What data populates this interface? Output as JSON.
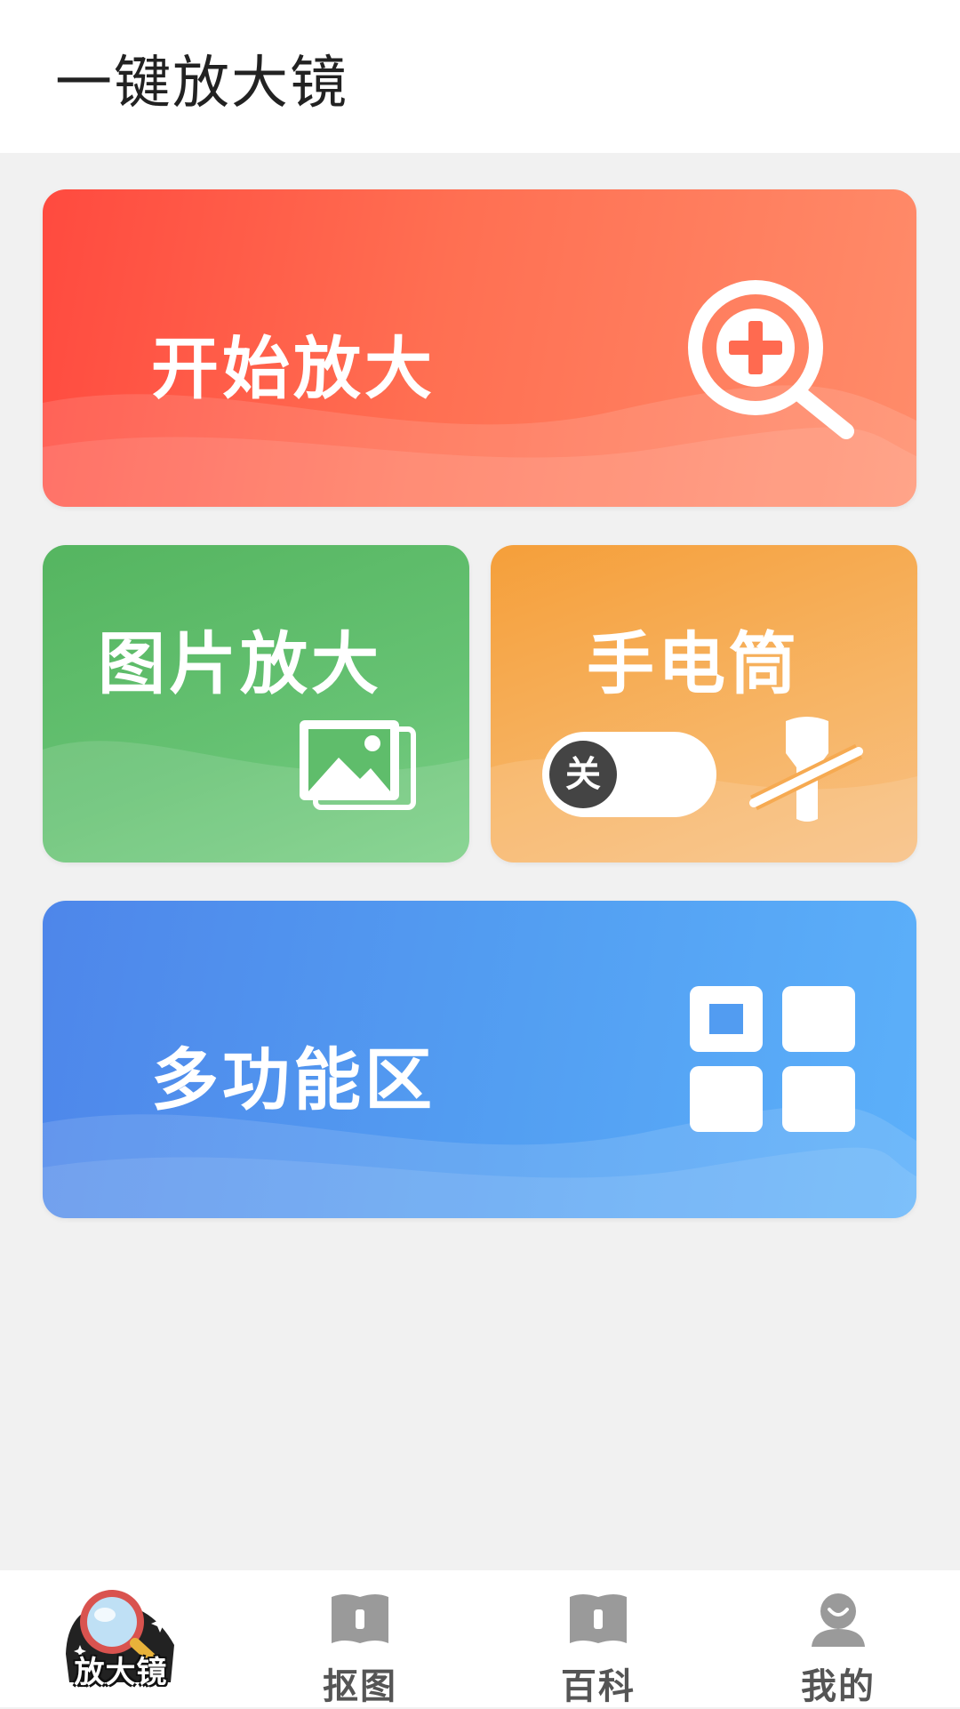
{
  "app": {
    "title": "一键放大镜"
  },
  "cards": {
    "zoom": {
      "label": "开始放大",
      "icon": "zoom-in-icon"
    },
    "picture": {
      "label": "图片放大",
      "icon": "image-icon"
    },
    "flashlight": {
      "label": "手电筒",
      "toggle_label": "关",
      "toggle_state": "off",
      "icon": "flashlight-off-icon"
    },
    "multi": {
      "label": "多功能区",
      "icon": "grid-icon"
    }
  },
  "tabbar": {
    "tabs": [
      {
        "label": "放大镜",
        "icon": "magnifier-logo-icon",
        "active": true
      },
      {
        "label": "抠图",
        "icon": "book-icon"
      },
      {
        "label": "百科",
        "icon": "book-icon"
      },
      {
        "label": "我的",
        "icon": "user-icon"
      }
    ]
  },
  "colors": {
    "zoom_card": "#ff5a47",
    "picture_card": "#5fbd6b",
    "flashlight_card": "#f6aa52",
    "multi_card": "#529cf1",
    "background": "#f1f1f1"
  }
}
